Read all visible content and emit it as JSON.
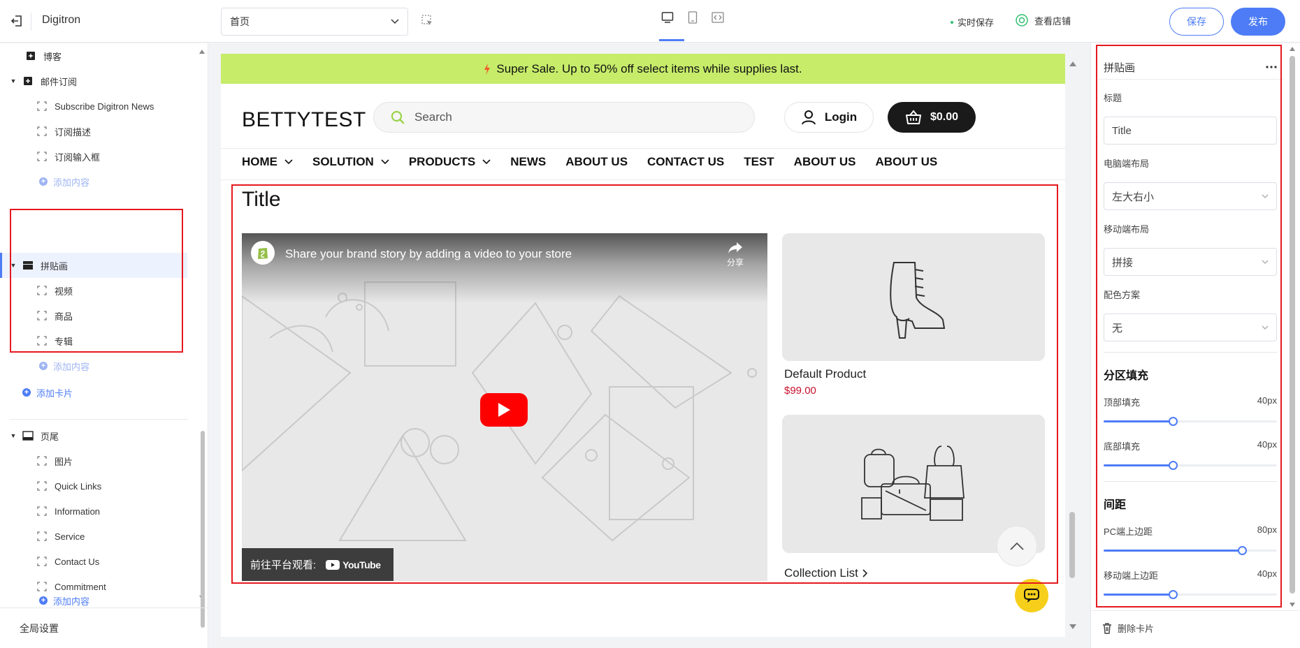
{
  "topbar": {
    "app_title": "Digitron",
    "page_select_value": "首页",
    "autosave_label": "实时保存",
    "view_store_label": "查看店铺",
    "save_label": "保存",
    "publish_label": "发布"
  },
  "sidebar": {
    "items": [
      {
        "label": "博客",
        "level": 0,
        "icon": "blog-icon"
      },
      {
        "label": "邮件订阅",
        "level": 0,
        "icon": "plus-square-icon",
        "expanded": true
      },
      {
        "label": "Subscribe Digitron News",
        "level": 1
      },
      {
        "label": "订阅描述",
        "level": 1
      },
      {
        "label": "订阅输入框",
        "level": 1
      },
      {
        "label": "添加内容",
        "level": 1,
        "type": "add"
      },
      {
        "label": "拼贴画",
        "level": 0,
        "icon": "collage-icon",
        "expanded": true,
        "selected": true
      },
      {
        "label": "视频",
        "level": 1
      },
      {
        "label": "商品",
        "level": 1
      },
      {
        "label": "专辑",
        "level": 1
      },
      {
        "label": "添加内容",
        "level": 1,
        "type": "add"
      },
      {
        "label": "添加卡片",
        "level": 0,
        "type": "add-card"
      },
      {
        "label": "页尾",
        "level": 0,
        "icon": "footer-icon",
        "expanded": true
      },
      {
        "label": "图片",
        "level": 1
      },
      {
        "label": "Quick Links",
        "level": 1
      },
      {
        "label": "Information",
        "level": 1
      },
      {
        "label": "Service",
        "level": 1
      },
      {
        "label": "Contact Us",
        "level": 1
      },
      {
        "label": "Commitment",
        "level": 1
      },
      {
        "label": "添加内容",
        "level": 1,
        "type": "add-blue"
      }
    ],
    "global_settings_label": "全局设置"
  },
  "preview": {
    "announcement": "Super Sale. Up to 50% off select items while supplies last.",
    "logo": "BETTYTEST",
    "search_placeholder": "Search",
    "login_label": "Login",
    "cart_total": "$0.00",
    "nav": [
      {
        "label": "HOME",
        "dropdown": true
      },
      {
        "label": "SOLUTION",
        "dropdown": true
      },
      {
        "label": "PRODUCTS",
        "dropdown": true
      },
      {
        "label": "NEWS",
        "dropdown": false
      },
      {
        "label": "ABOUT US",
        "dropdown": false
      },
      {
        "label": "CONTACT US",
        "dropdown": false
      },
      {
        "label": "TEST",
        "dropdown": false
      },
      {
        "label": "ABOUT US",
        "dropdown": false
      },
      {
        "label": "ABOUT US",
        "dropdown": false
      }
    ],
    "section_title": "Title",
    "video": {
      "title": "Share your brand story by adding a video to your store",
      "share_label": "分享",
      "watch_on_label": "前往平台观看:",
      "platform_label": "YouTube"
    },
    "product": {
      "name": "Default Product",
      "price": "$99.00"
    },
    "collection": {
      "name": "Collection List"
    }
  },
  "panel": {
    "header_title": "拼贴画",
    "title_label": "标题",
    "title_value": "Title",
    "desktop_layout_label": "电脑端布局",
    "desktop_layout_value": "左大右小",
    "mobile_layout_label": "移动端布局",
    "mobile_layout_value": "拼接",
    "color_scheme_label": "配色方案",
    "color_scheme_value": "无",
    "padding_section": "分区填充",
    "top_padding_label": "顶部填充",
    "top_padding_value": "40px",
    "top_padding_fraction": 0.4,
    "bottom_padding_label": "底部填充",
    "bottom_padding_value": "40px",
    "bottom_padding_fraction": 0.4,
    "spacing_section": "间距",
    "pc_margin_label": "PC端上边距",
    "pc_margin_value": "80px",
    "pc_margin_fraction": 0.8,
    "mobile_margin_label": "移动端上边距",
    "mobile_margin_value": "40px",
    "mobile_margin_fraction": 0.4,
    "delete_card_label": "删除卡片"
  },
  "colors": {
    "accent": "#4d7cf6",
    "announcement_bg": "#c6ec6a",
    "price": "#c8102e",
    "highlight_border": "#e5191f",
    "chat_button": "#f6cf1b"
  }
}
